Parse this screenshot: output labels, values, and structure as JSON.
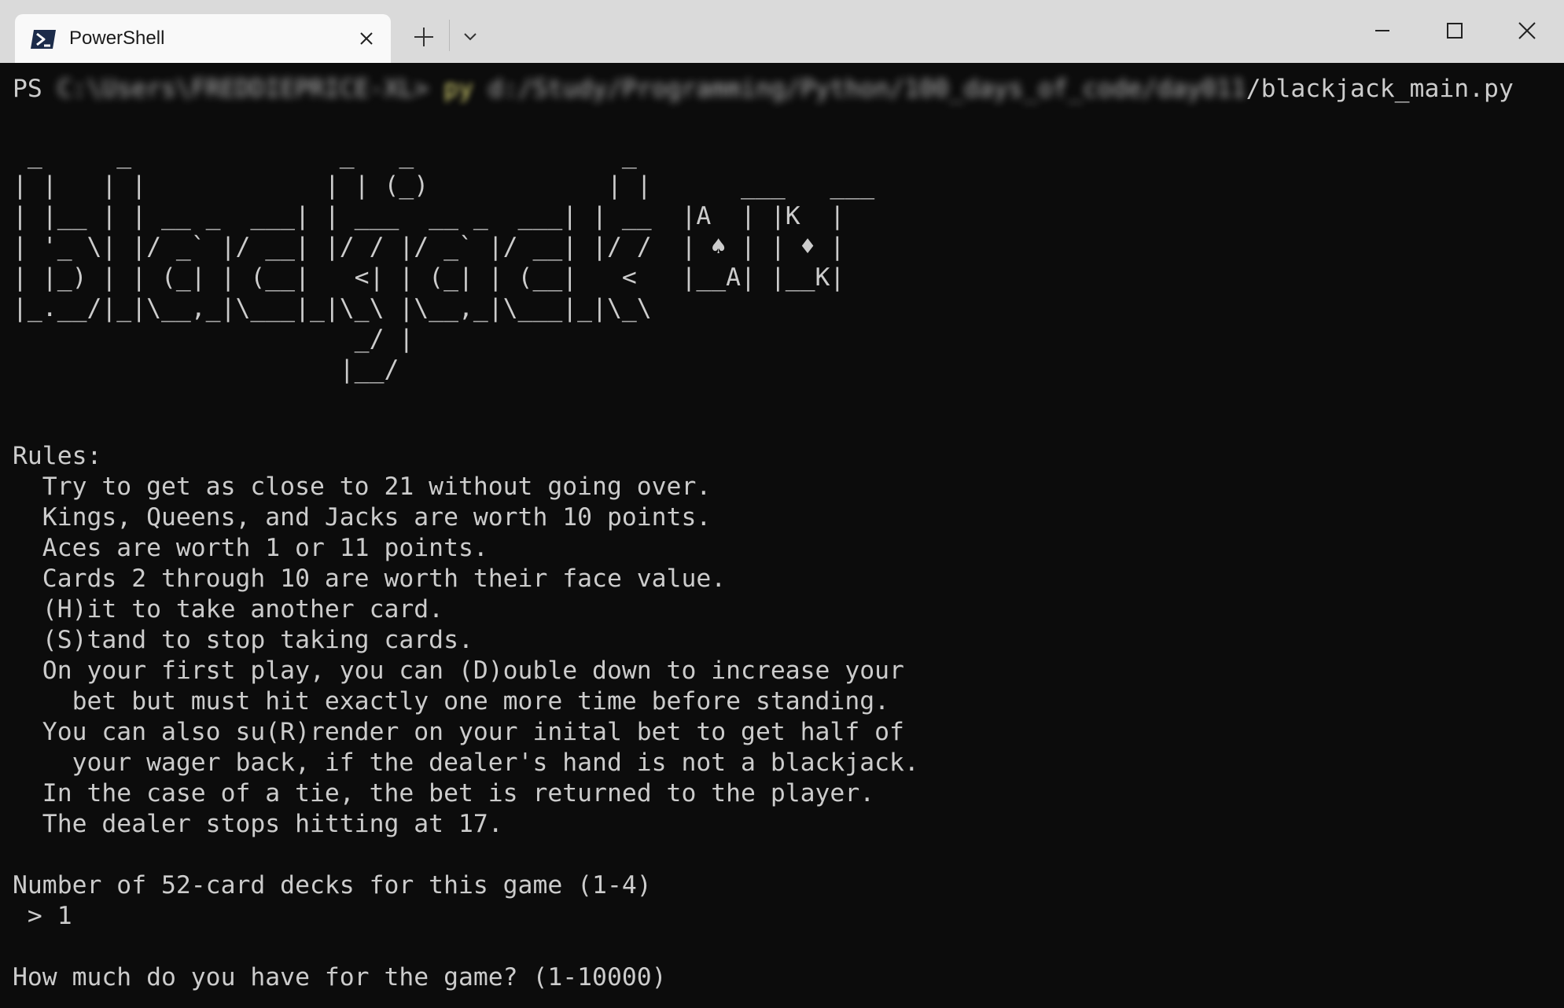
{
  "window": {
    "tab_title": "PowerShell",
    "icons": {
      "tab": "powershell-icon",
      "tab_close": "close-icon",
      "new_tab": "plus-icon",
      "dropdown": "chevron-down-icon",
      "minimize": "minimize-icon",
      "maximize": "maximize-icon",
      "close": "close-icon"
    },
    "colors": {
      "titlebar": "#dadada",
      "tab": "#f9f9f9",
      "terminal_bg": "#0c0c0c",
      "terminal_text": "#cccccc",
      "command_highlight": "#e5e07a"
    }
  },
  "terminal": {
    "prompt": {
      "ps": "PS",
      "path_blurred": "C:\\Users\\FREDDIEPRICE-XL>",
      "cmd_blurred": "py",
      "script_dir_blurred": "d:/Study/Programming/Python/100_days_of_code/day011",
      "script_name": "/blackjack_main.py"
    },
    "ascii_art": " _     _              _   _              _\n| |   | |            | | (_)            | |      ___   ___\n| |__ | | __ _  ___| | ___  __ _  ___| | __  |A  | |K  |\n| '_ \\| |/ _` |/ __| |/ / |/ _` |/ __| |/ /  | ♠ | | ♦ |\n| |_) | | (_| | (__|   <| | (_| | (__|   <   |__A| |__K|\n|_.__/|_|\\__,_|\\___|_|\\_\\ |\\__,_|\\___|_|\\_\\\n                       _/ |\n                      |__/",
    "rules_heading": "Rules:",
    "rules": [
      "  Try to get as close to 21 without going over.",
      "  Kings, Queens, and Jacks are worth 10 points.",
      "  Aces are worth 1 or 11 points.",
      "  Cards 2 through 10 are worth their face value.",
      "  (H)it to take another card.",
      "  (S)tand to stop taking cards.",
      "  On your first play, you can (D)ouble down to increase your",
      "    bet but must hit exactly one more time before standing.",
      "  You can also su(R)render on your inital bet to get half of",
      "    your wager back, if the dealer's hand is not a blackjack.",
      "  In the case of a tie, the bet is returned to the player.",
      "  The dealer stops hitting at 17."
    ],
    "decks_question": "Number of 52-card decks for this game (1-4)",
    "decks_answer": " > 1",
    "money_question": "How much do you have for the game? (1-10000)"
  }
}
